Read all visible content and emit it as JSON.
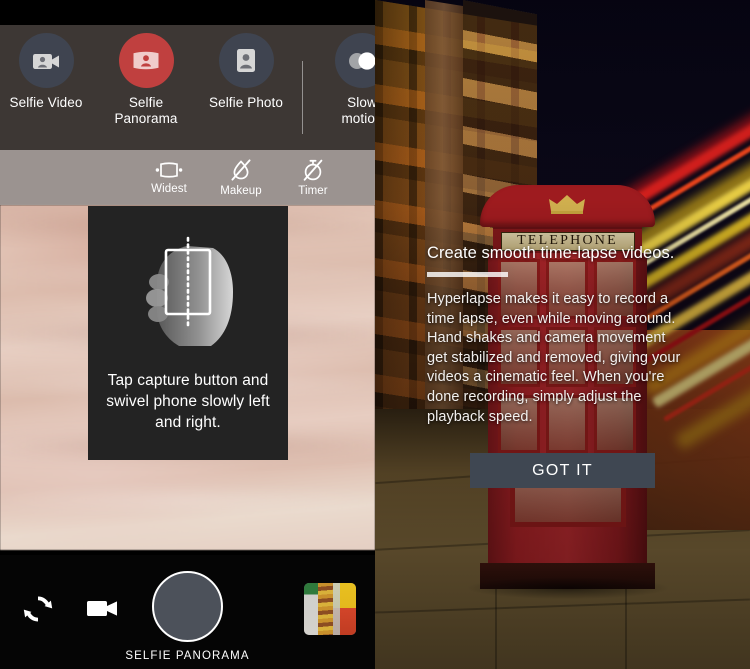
{
  "left_panel": {
    "modes": [
      {
        "id": "selfie-video",
        "label": "Selfie Video",
        "icon": "selfie-video-icon",
        "active": false
      },
      {
        "id": "selfie-panorama",
        "label": "Selfie\nPanorama",
        "icon": "selfie-panorama-icon",
        "active": true
      },
      {
        "id": "selfie-photo",
        "label": "Selfie Photo",
        "icon": "selfie-photo-icon",
        "active": false
      },
      {
        "id": "slow-motion",
        "label": "Slow\nmotion",
        "icon": "slow-motion-icon",
        "active": false
      }
    ],
    "mode_expand_icon": "chevron-down-icon",
    "options": [
      {
        "id": "widest",
        "label": "Widest",
        "icon": "widest-icon"
      },
      {
        "id": "makeup",
        "label": "Makeup",
        "icon": "makeup-off-icon"
      },
      {
        "id": "timer",
        "label": "Timer",
        "icon": "timer-off-icon"
      }
    ],
    "instruction": {
      "illustration": "hand-holding-phone-swivel-icon",
      "text": "Tap capture button and swivel phone slowly left and right."
    },
    "bottom_bar": {
      "switch_camera_icon": "switch-camera-icon",
      "video_mode_icon": "video-camera-icon",
      "capture_button_label": "capture-button",
      "capture_mode_label": "SELFIE PANORAMA",
      "gallery_thumbnail": "gallery-thumbnail"
    },
    "colors": {
      "accent_red": "#c0403f",
      "mode_circle": "#3f4450",
      "mode_bar_bg": "#3d3734",
      "options_bar_bg": "#a8a09c",
      "capture_fill": "#4c515a"
    }
  },
  "right_panel": {
    "scene_caption": "TELEPHONE",
    "headline": "Create smooth time-lapse videos.",
    "body": "Hyperlapse makes it easy to record a time lapse, even while moving around. Hand shakes and camera movement get stabilized and removed, giving your videos a cinematic feel. When you're done recording, simply adjust the playback speed.",
    "dismiss_button_label": "GOT IT",
    "colors": {
      "button_bg": "#3f4752",
      "rule": "#ffffff"
    }
  }
}
